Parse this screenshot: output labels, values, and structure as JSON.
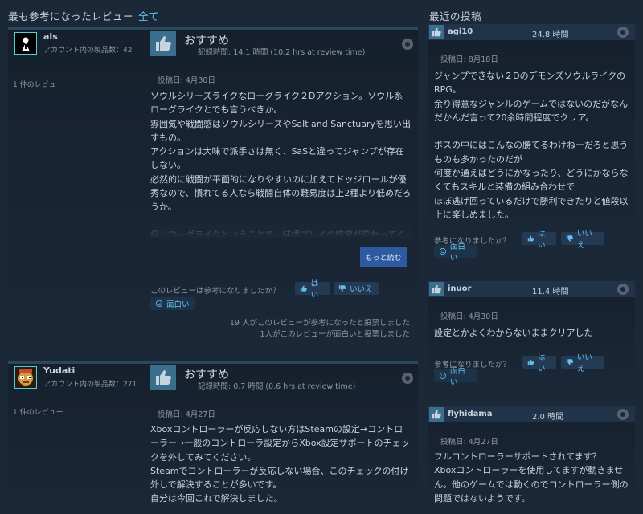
{
  "header": {
    "most_helpful": "最も参考になったレビュー",
    "all_link": "全て",
    "recent_posts": "最近の投稿"
  },
  "reviews": [
    {
      "username": "als",
      "products_label": "アカウント内の製品数：42",
      "review_count": "1 件のレビュー",
      "recommend": "おすすめ",
      "hours": "記録時間: 14.1 時間 (10.2 hrs at review time)",
      "posted": "投稿日: 4月30日",
      "body": "ソウルシリーズライクなローグライク２Dアクション。ソウル系ローグライクとでも言うべきか。\n雰囲気や戦闘感はソウルシリーズやSalt and Sanctuaryを思い出すもの。\nアクションは大味で派手さは無く、SaSと違ってジャンプが存在しない。\n必然的に戦闘が平面的になりやすいのに加えてドッジロールが優秀なので、慣れてる人なら戦闘自体の難易度は上2種より低めだろうか。\n\n但しローグライクということで、結構プレイの感覚が変わってく",
      "read_more": "もっと読む",
      "helpful_q": "このレビューは参考になりましたか？",
      "yes": "はい",
      "no": "いいえ",
      "funny": "面白い",
      "tally_helpful": "19 人がこのレビューが参考になったと投票しました",
      "tally_funny": "1人がこのレビューが面白いと投票しました"
    },
    {
      "username": "Yudati",
      "products_label": "アカウント内の製品数：271",
      "review_count": "1 件のレビュー",
      "recommend": "おすすめ",
      "hours": "記録時間: 0.7 時間 (0.6 hrs at review time)",
      "posted": "投稿日: 4月27日",
      "body": "Xboxコントローラーが反応しない方はSteamの設定→コントローラー→一般のコントローラ設定からXbox設定サポートのチェックを外してみてください。\nSteamでコントローラーが反応しない場合、このチェックの付け外しで解決することが多いです。\n自分は今回これで解決しました。"
    }
  ],
  "recent": [
    {
      "username": "agi10",
      "hours": "24.8 時間",
      "posted": "投稿日: 8月18日",
      "body": "ジャンプできない２Dのデモンズソウルライクの\nRPG。\n余り得意なジャンルのゲームではないのだがなんだかんだ言って20余時間程度でクリア。\n\nボスの中にはこんなの勝てるわけねーだろと思うものも多かったのだが\n何度か通えばどうにかなったり、どうにかならなくてもスキルと装備の組み合わせで\nほぼ逃げ回っているだけで勝利できたりと値段以上に楽しめました。",
      "helpful_q": "参考になりましたか？",
      "yes": "はい",
      "no": "いいえ",
      "funny": "面白い"
    },
    {
      "username": "inuor",
      "hours": "11.4 時間",
      "posted": "投稿日: 4月30日",
      "body": "設定とかよくわからないままクリアした",
      "helpful_q": "参考になりましたか？",
      "yes": "はい",
      "no": "いいえ",
      "funny": "面白い"
    },
    {
      "username": "flyhidama",
      "hours": "2.0 時間",
      "posted": "投稿日: 4月27日",
      "body": "フルコントローラーサポートされてます？\nXboxコントローラーを使用してますが動きません。他のゲームでは動くのでコントローラー側の問題ではないようです。"
    }
  ]
}
